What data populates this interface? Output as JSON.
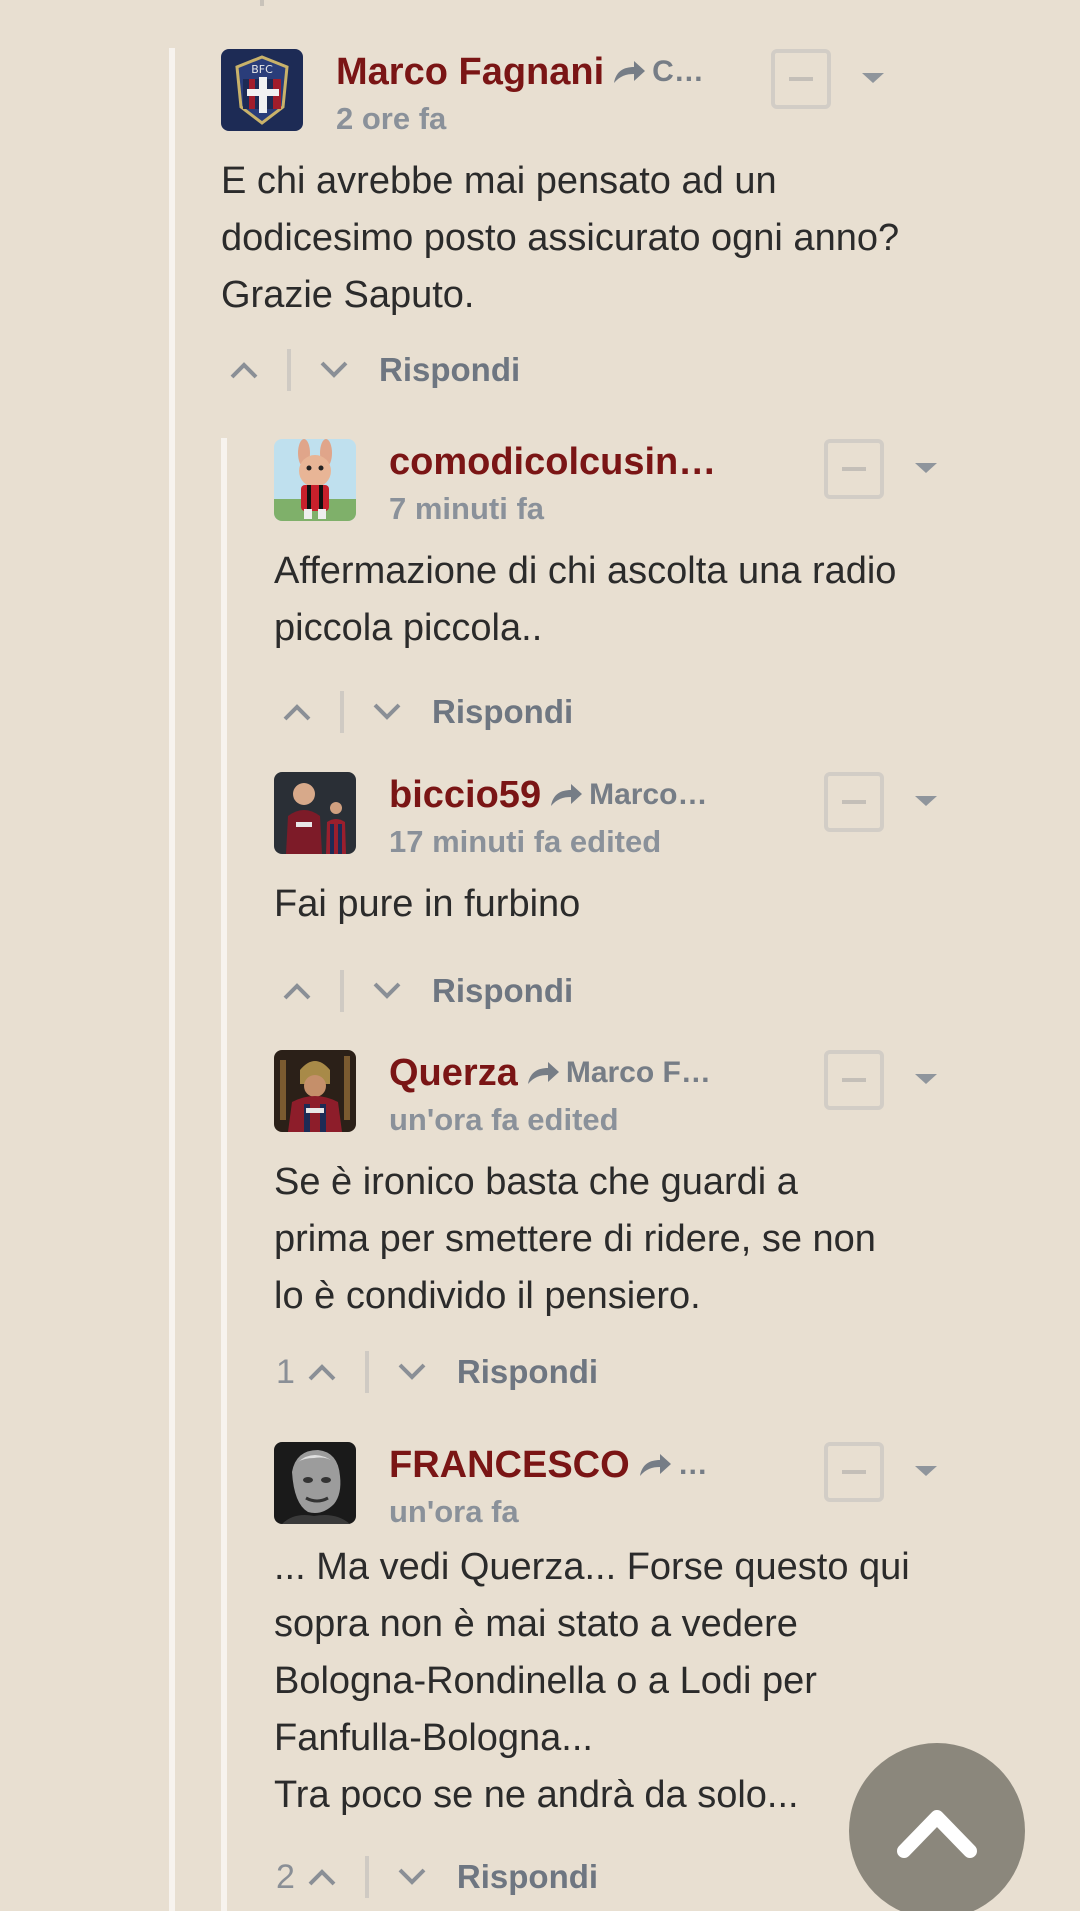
{
  "comments": [
    {
      "author": "Marco Fagnani",
      "reply_to": "C…",
      "time": "2 ore fa",
      "edited": "",
      "body": [
        "E chi avrebbe mai pensato ad un dodicesimo posto assicurato ogni anno? Grazie Saputo."
      ],
      "votes": "",
      "reply_label": "Rispondi",
      "avatar_icon": "bfc-crest-avatar"
    },
    {
      "author": "comodicolcusin…",
      "reply_to": "",
      "time": "7 minuti fa",
      "edited": "",
      "body": [
        "Affermazione di chi ascolta una radio piccola piccola.."
      ],
      "votes": "",
      "reply_label": "Rispondi",
      "avatar_icon": "cartoon-rabbit-avatar"
    },
    {
      "author": "biccio59",
      "reply_to": "Marco…",
      "time": "17 minuti fa",
      "edited": "edited",
      "body": [
        "Fai pure in furbino"
      ],
      "votes": "",
      "reply_label": "Rispondi",
      "avatar_icon": "football-players-avatar"
    },
    {
      "author": "Querza",
      "reply_to": "Marco F…",
      "time": "un'ora fa",
      "edited": "edited",
      "body": [
        "Se è ironico basta che guardi a prima per smettere di ridere, se non lo è condivido il pensiero."
      ],
      "votes": "1",
      "reply_label": "Rispondi",
      "avatar_icon": "gladiator-avatar"
    },
    {
      "author": "FRANCESCO",
      "reply_to": "…",
      "time": "un'ora fa",
      "edited": "",
      "body": [
        "... Ma vedi Querza... Forse questo qui sopra non è mai stato a vedere Bologna-Rondinella o a Lodi per Fanfulla-Bologna...",
        "Tra poco se ne andrà da solo..."
      ],
      "votes": "2",
      "reply_label": "Rispondi",
      "avatar_icon": "man-portrait-avatar"
    }
  ],
  "colors": {
    "background": "#e8dfd1",
    "author": "#7a1515",
    "meta": "#8a919a",
    "scroll_button": "#8b877c"
  },
  "scroll_top_icon": "chevron-up-icon"
}
